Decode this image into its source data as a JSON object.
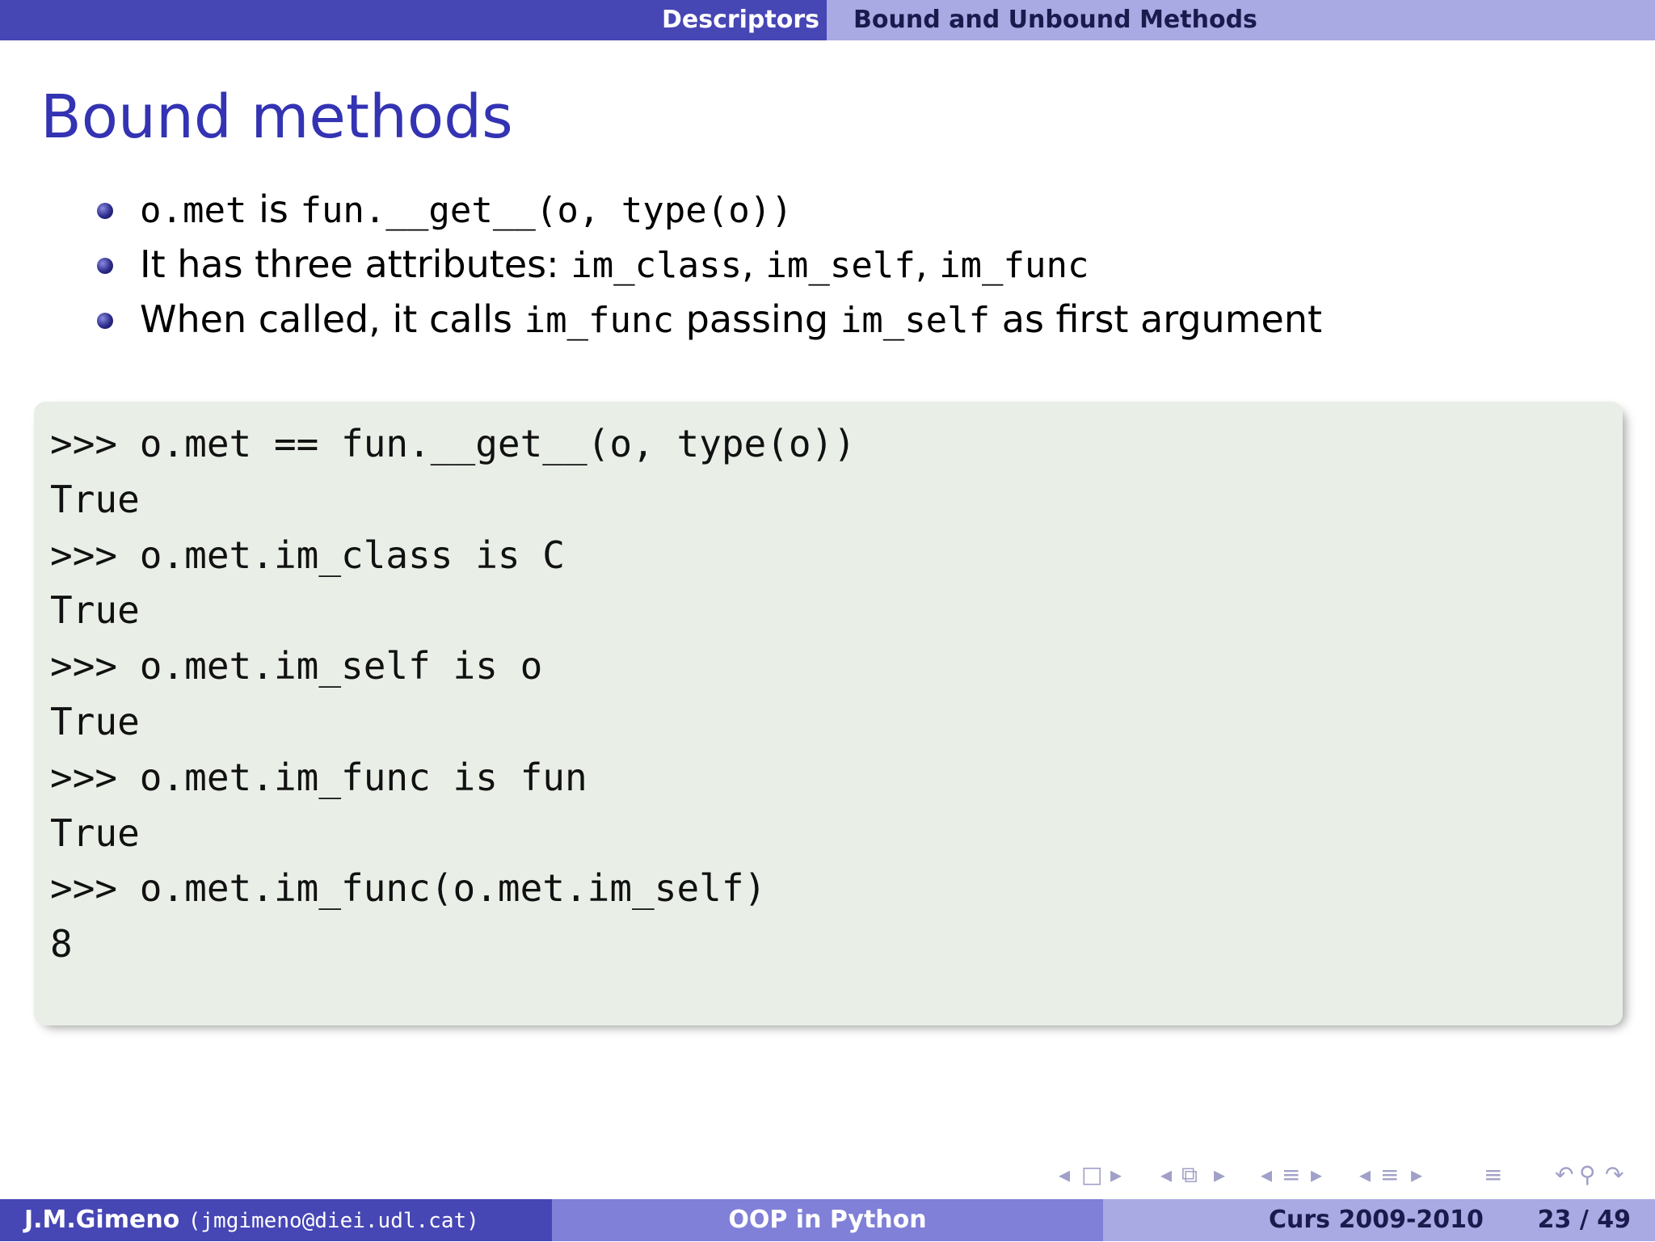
{
  "header": {
    "section": "Descriptors",
    "subsection": "Bound and Unbound Methods"
  },
  "slide": {
    "title": "Bound methods"
  },
  "bullets": [
    {
      "parts": [
        {
          "text": "o.met",
          "mono": true
        },
        {
          "text": " is ",
          "mono": false
        },
        {
          "text": "fun.__get__(o, type(o))",
          "mono": true
        }
      ]
    },
    {
      "parts": [
        {
          "text": "It has three attributes: ",
          "mono": false
        },
        {
          "text": "im_class",
          "mono": true
        },
        {
          "text": ", ",
          "mono": false
        },
        {
          "text": "im_self",
          "mono": true
        },
        {
          "text": ", ",
          "mono": false
        },
        {
          "text": "im_func",
          "mono": true
        }
      ]
    },
    {
      "parts": [
        {
          "text": "When called, it calls ",
          "mono": false
        },
        {
          "text": "im_func",
          "mono": true
        },
        {
          "text": " passing ",
          "mono": false
        },
        {
          "text": "im_self",
          "mono": true
        },
        {
          "text": " as first argument",
          "mono": false
        }
      ]
    }
  ],
  "code": {
    "lines": [
      ">>> o.met == fun.__get__(o, type(o))",
      "True",
      ">>> o.met.im_class is C",
      "True",
      ">>> o.met.im_self is o",
      "True",
      ">>> o.met.im_func is fun",
      "True",
      ">>> o.met.im_func(o.met.im_self)",
      "8"
    ]
  },
  "nav": {
    "icons": [
      "frame-prev-icon",
      "frame-icon",
      "frame-next-icon",
      "subsection-prev-icon",
      "subsection-icon",
      "subsection-next-icon",
      "section-prev-icon",
      "section-icon",
      "section-next-icon",
      "slide-prev-icon",
      "slide-icon",
      "slide-next-icon",
      "outline-icon",
      "undo-icon",
      "search-icon",
      "redo-icon"
    ]
  },
  "footer": {
    "author": "J.M.Gimeno",
    "email": "(jmgimeno@diei.udl.cat)",
    "title": "OOP in Python",
    "course": "Curs 2009-2010",
    "pages": "23 / 49"
  },
  "colors": {
    "header_dark": "#4646b5",
    "header_light": "#a9a9e3",
    "title": "#3333b3",
    "code_bg": "#e9efe7"
  }
}
